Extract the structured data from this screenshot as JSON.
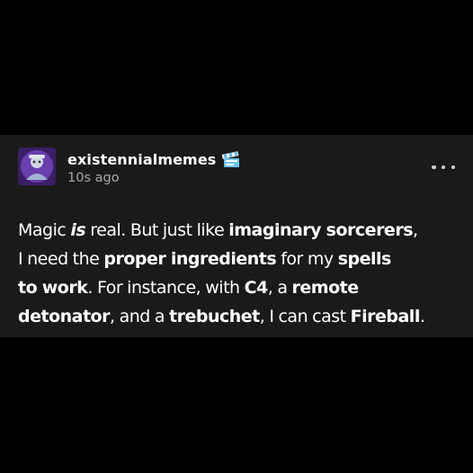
{
  "post": {
    "username": "existennialmemes",
    "timestamp": "10s ago",
    "badge_icon": "film-clapper-badge-icon",
    "more_icon": "more-options-icon",
    "colors": {
      "background": "#000000",
      "card": "#1a1a1a",
      "text": "#ffffff",
      "muted": "#a8a8a8"
    },
    "body": {
      "l1_a": "Magic ",
      "l1_b": "is",
      "l1_c": " real. But just like ",
      "l1_d": "imaginary sorcerers",
      "l1_e": ",",
      "l2_a": "I need the ",
      "l2_b": "proper ingredients",
      "l2_c": " for my ",
      "l2_d": "spells",
      "l3_a": "to work",
      "l3_b": ". For instance, with ",
      "l3_c": "C4",
      "l3_d": ", a ",
      "l3_e": "remote",
      "l4_a": "detonator",
      "l4_b": ", and a ",
      "l4_c": "trebuchet",
      "l4_d": ", I can cast ",
      "l4_e": "Fireball",
      "l4_f": "."
    }
  }
}
